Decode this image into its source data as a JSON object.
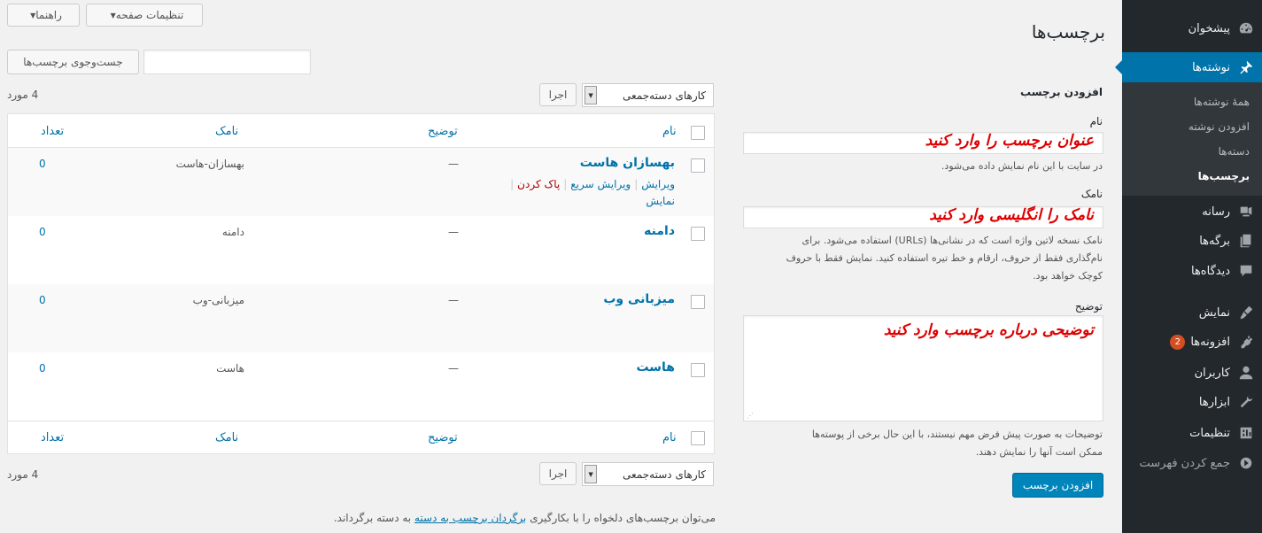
{
  "sidebar": {
    "items": [
      {
        "label": "پیشخوان",
        "icon": "dashboard-icon"
      },
      {
        "label": "نوشته‌ها",
        "icon": "pin-icon",
        "active": true
      },
      {
        "label": "رسانه",
        "icon": "media-icon"
      },
      {
        "label": "برگه‌ها",
        "icon": "pages-icon"
      },
      {
        "label": "دیدگاه‌ها",
        "icon": "comments-icon"
      },
      {
        "label": "نمایش",
        "icon": "appearance-icon"
      },
      {
        "label": "افزونه‌ها",
        "icon": "plugins-icon",
        "badge": "2"
      },
      {
        "label": "کاربران",
        "icon": "users-icon"
      },
      {
        "label": "ابزارها",
        "icon": "tools-icon"
      },
      {
        "label": "تنظیمات",
        "icon": "settings-icon"
      },
      {
        "label": "جمع کردن فهرست",
        "icon": "collapse-icon"
      }
    ],
    "submenu": [
      "همهٔ نوشته‌ها",
      "افزودن نوشته",
      "دسته‌ها",
      "برچسب‌ها"
    ]
  },
  "screen_meta": {
    "help_label": "راهنما",
    "options_label": "تنظیمات صفحه"
  },
  "page_title": "برچسب‌ها",
  "search": {
    "button_label": "جست‌وجوی برچسب‌ها",
    "value": ""
  },
  "add_form": {
    "heading": "افزودن برچسب",
    "name_label": "نام",
    "name_overlay": "عنوان برچسب را وارد کنید",
    "name_help": "در سایت با این نام نمایش داده می‌شود.",
    "slug_label": "نامک",
    "slug_overlay": "نامک را انگلیسی وارد کنید",
    "slug_help_1": "نامک نسخه لاتین واژه است که در نشانی‌ها (URLs) استفاده می‌شود. برای",
    "slug_help_2": "نام‌گذاری فقط از حروف، ارقام و خط تیره استفاده کنید. نمایش فقط با حروف",
    "slug_help_3": "کوچک خواهد بود.",
    "desc_label": "توضیح",
    "desc_overlay": "توضیحی درباره برچسب وارد کنید",
    "desc_help_1": "توضیحات به صورت پیش فرض مهم نیستند، با این حال برخی از پوسته‌ها",
    "desc_help_2": "ممکن است آنها را نمایش دهند.",
    "submit_label": "افزودن برچسب"
  },
  "bulk": {
    "select_label": "کارهای دسته‌جمعی",
    "apply_label": "اجرا",
    "count_label": "4 مورد"
  },
  "table": {
    "headers": {
      "name": "نام",
      "description": "توضیح",
      "slug": "نامک",
      "count": "تعداد"
    },
    "rows": [
      {
        "name": "بهسازان هاست",
        "description": "—",
        "slug": "بهسازان-هاست",
        "count": "0"
      },
      {
        "name": "دامنه",
        "description": "—",
        "slug": "دامنه",
        "count": "0"
      },
      {
        "name": "میزبانی وب",
        "description": "—",
        "slug": "میزبانی-وب",
        "count": "0"
      },
      {
        "name": "هاست",
        "description": "—",
        "slug": "هاست",
        "count": "0"
      }
    ],
    "row_actions": {
      "edit": "ویرایش",
      "quick_edit": "ویرایش سریع",
      "delete": "پاک کردن",
      "view": "نمایش"
    }
  },
  "footer_note": {
    "before": "می‌توان برچسب‌های دلخواه را با بکارگیری",
    "link": "برگردان برچسب به دسته",
    "after": "به دسته برگرداند."
  },
  "colors": {
    "accent": "#0073aa",
    "sidebar_bg": "#23282d",
    "overlay_text": "#dd0000",
    "badge": "#d54e21"
  }
}
